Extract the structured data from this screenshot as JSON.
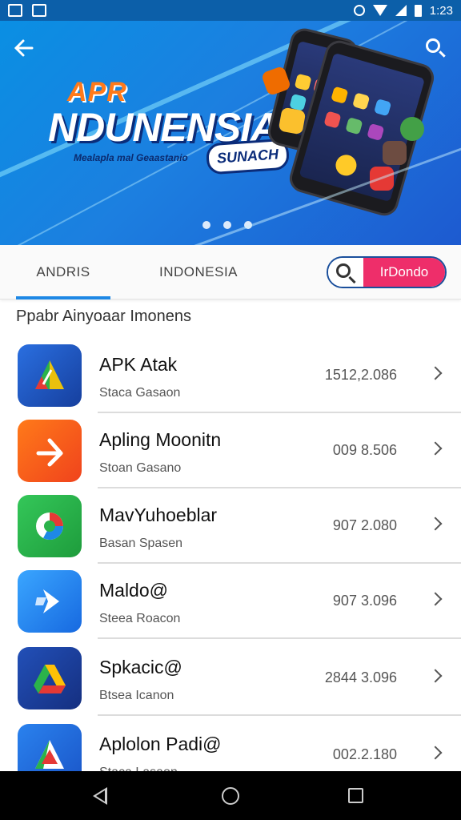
{
  "status_bar": {
    "time": "1:23"
  },
  "hero": {
    "tag": "APR",
    "title": "NDUNENSIA",
    "subtitle": "Mealapla mal Geaastanio",
    "badge": "SUNACH",
    "page_count": 3,
    "active_page": 1
  },
  "tabs": [
    {
      "label": "ANDRIS"
    },
    {
      "label": "INDONESIA"
    }
  ],
  "search_pill": {
    "label": "IrDondo"
  },
  "section": {
    "title": "Ppabr Ainyoaar Imonens"
  },
  "apps": [
    {
      "name": "APK Atak",
      "sub": "Staca Gasaon",
      "count": "1512,2.086",
      "color": "#1d4fb8"
    },
    {
      "name": "Apling Moonitn",
      "sub": "Stoan Gasano",
      "count": "009 8.506",
      "color": "#f2591a"
    },
    {
      "name": "MavYuhoeblar",
      "sub": "Basan Spasen",
      "count": "907 2.080",
      "color": "#2eb84a"
    },
    {
      "name": "Maldo@",
      "sub": "Steea Roacon",
      "count": "907 3.096",
      "color": "#1f8fee"
    },
    {
      "name": "Spkacic@",
      "sub": "Btsea Icanon",
      "count": "2844 3.096",
      "color": "#1b3f9b"
    },
    {
      "name": "Aplolon Padi@",
      "sub": "Staca Lasaon",
      "count": "002.2.180",
      "color": "#1f6fe0"
    }
  ]
}
